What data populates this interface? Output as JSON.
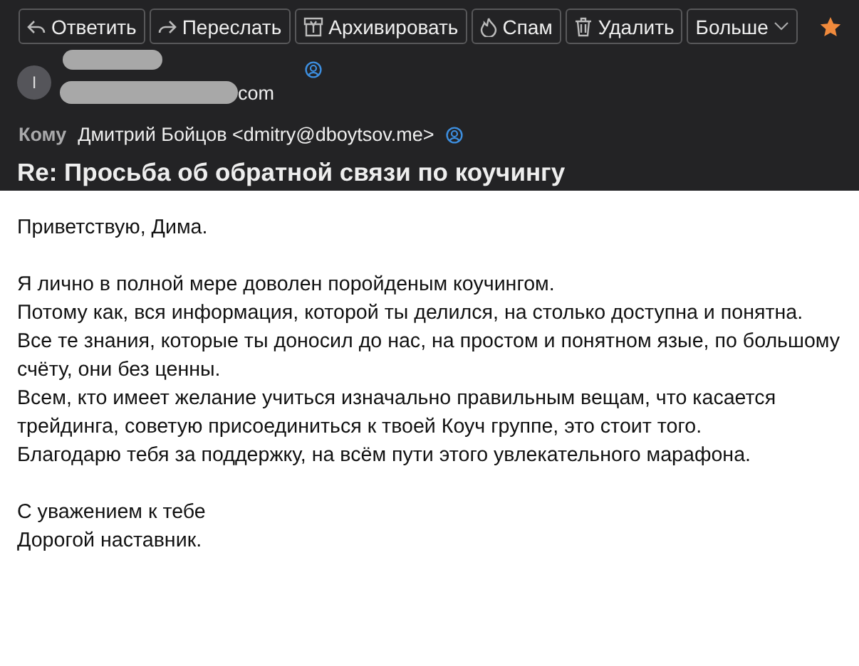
{
  "toolbar": {
    "buttons": [
      {
        "kind": "reply",
        "label": "Ответить"
      },
      {
        "kind": "forward",
        "label": "Переслать"
      },
      {
        "kind": "archive",
        "label": "Архивировать"
      },
      {
        "kind": "spam",
        "label": "Спам"
      },
      {
        "kind": "delete",
        "label": "Удалить"
      },
      {
        "kind": "more",
        "label": "Больше"
      }
    ],
    "starred": true
  },
  "sender": {
    "avatar": "I",
    "address_tail": "com"
  },
  "recipient": {
    "label": "Кому",
    "value": "Дмитрий Бойцов <dmitry@dboytsov.me>"
  },
  "subject": "Re: Просьба об обратной связи по коучингу",
  "body": [
    [
      "Приветствую, Дима."
    ],
    [
      "Я лично в полной мере доволен поройденым коучингом.",
      "Потому как, вся информация, которой ты делился, на столько доступна и понятна.",
      "Все те знания, которые ты доносил до нас, на простом и понятном язые, по большому счёту, они без ценны.",
      "Всем, кто имеет желание учиться изначально правильным вещам, что касается трейдинга, советую присоединиться к твоей Коуч группе, это стоит того.",
      "Благодарю тебя за поддержку, на всём пути этого увлекательного марафона."
    ],
    [
      "С уважением к тебе",
      "Дорогой наставник."
    ]
  ]
}
